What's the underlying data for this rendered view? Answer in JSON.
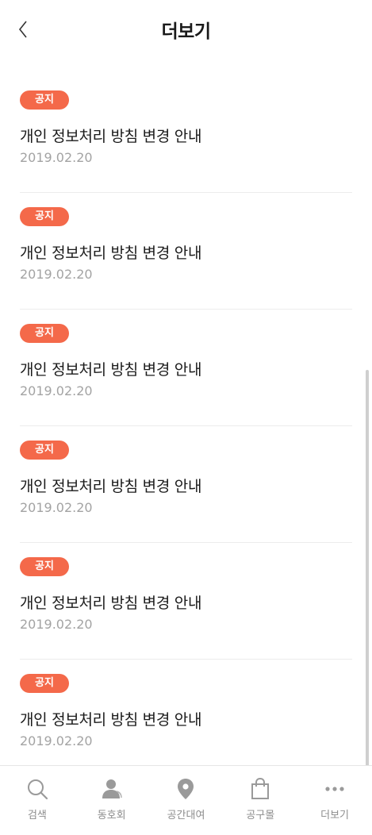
{
  "header": {
    "title": "더보기"
  },
  "notices": [
    {
      "badge": "공지",
      "title": "개인 정보처리 방침 변경 안내",
      "date": "2019.02.20"
    },
    {
      "badge": "공지",
      "title": "개인 정보처리 방침 변경 안내",
      "date": "2019.02.20"
    },
    {
      "badge": "공지",
      "title": "개인 정보처리 방침 변경 안내",
      "date": "2019.02.20"
    },
    {
      "badge": "공지",
      "title": "개인 정보처리 방침 변경 안내",
      "date": "2019.02.20"
    },
    {
      "badge": "공지",
      "title": "개인 정보처리 방침 변경 안내",
      "date": "2019.02.20"
    },
    {
      "badge": "공지",
      "title": "개인 정보처리 방침 변경 안내",
      "date": "2019.02.20"
    }
  ],
  "tabbar": {
    "items": [
      {
        "label": "검색",
        "icon": "search-icon"
      },
      {
        "label": "동호회",
        "icon": "person-icon"
      },
      {
        "label": "공간대여",
        "icon": "location-pin-icon"
      },
      {
        "label": "공구몰",
        "icon": "shopping-bag-icon"
      },
      {
        "label": "더보기",
        "icon": "more-dots-icon"
      }
    ]
  },
  "colors": {
    "accent": "#f4694a",
    "date": "#a3a3a3",
    "tab_icon": "#9a9a9a"
  }
}
